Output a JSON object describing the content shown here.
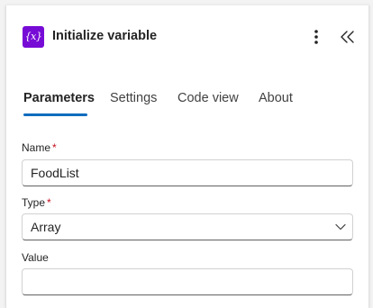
{
  "header": {
    "action_icon_text": "{x}",
    "title": "Initialize variable",
    "more_icon": "more-vertical-icon",
    "collapse_icon": "double-chevron-left-icon"
  },
  "tabs": [
    {
      "label": "Parameters",
      "active": true
    },
    {
      "label": "Settings",
      "active": false
    },
    {
      "label": "Code view",
      "active": false
    },
    {
      "label": "About",
      "active": false
    }
  ],
  "form": {
    "name": {
      "label": "Name",
      "required_mark": "*",
      "value": "FoodList"
    },
    "type": {
      "label": "Type",
      "required_mark": "*",
      "value": "Array"
    },
    "value": {
      "label": "Value",
      "value": ""
    }
  },
  "colors": {
    "accent": "#0f6cbd",
    "action_icon_bg": "#770bd6",
    "required": "#c50f1f"
  }
}
